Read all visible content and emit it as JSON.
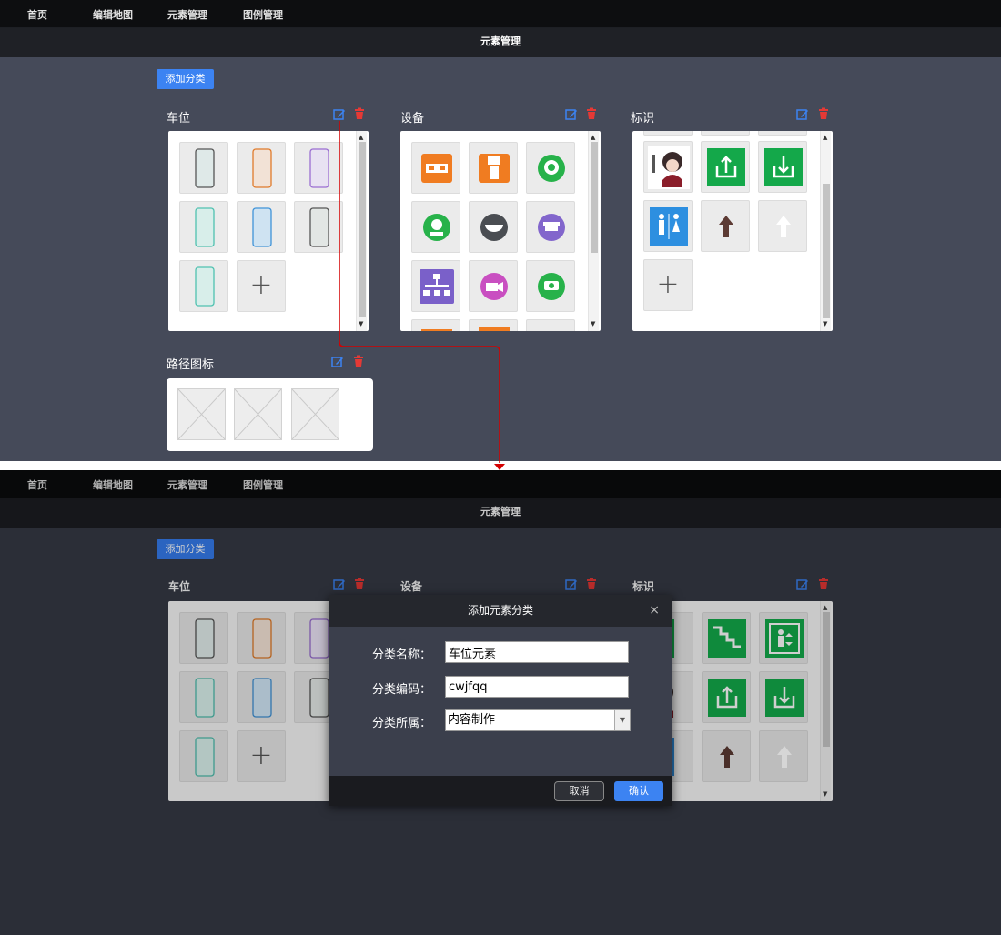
{
  "nav": {
    "items": [
      {
        "label": "首页"
      },
      {
        "label": "编辑地图"
      },
      {
        "label": "元素管理"
      },
      {
        "label": "图例管理"
      }
    ]
  },
  "page": {
    "title": "元素管理",
    "add_button": "添加分类"
  },
  "categories": {
    "parking": {
      "title": "车位"
    },
    "device": {
      "title": "设备"
    },
    "sign": {
      "title": "标识"
    },
    "path": {
      "title": "路径图标"
    }
  },
  "plus_symbol": "+",
  "modal": {
    "title": "添加元素分类",
    "close": "×",
    "fields": {
      "name": {
        "label": "分类名称：",
        "value": "车位元素"
      },
      "code": {
        "label": "分类编码：",
        "value": "cwjfqq"
      },
      "belong": {
        "label": "分类所属：",
        "value": "内容制作"
      }
    },
    "cancel": "取消",
    "confirm": "确认"
  },
  "colors": {
    "accent": "#3c83f2",
    "delete": "#e53935",
    "annotation_arrow": "#d40000"
  },
  "icons": {
    "edit": "edit-icon",
    "delete": "trash-icon",
    "parking_spot": "parking-spot-icon",
    "placeholder": "image-placeholder-icon"
  }
}
